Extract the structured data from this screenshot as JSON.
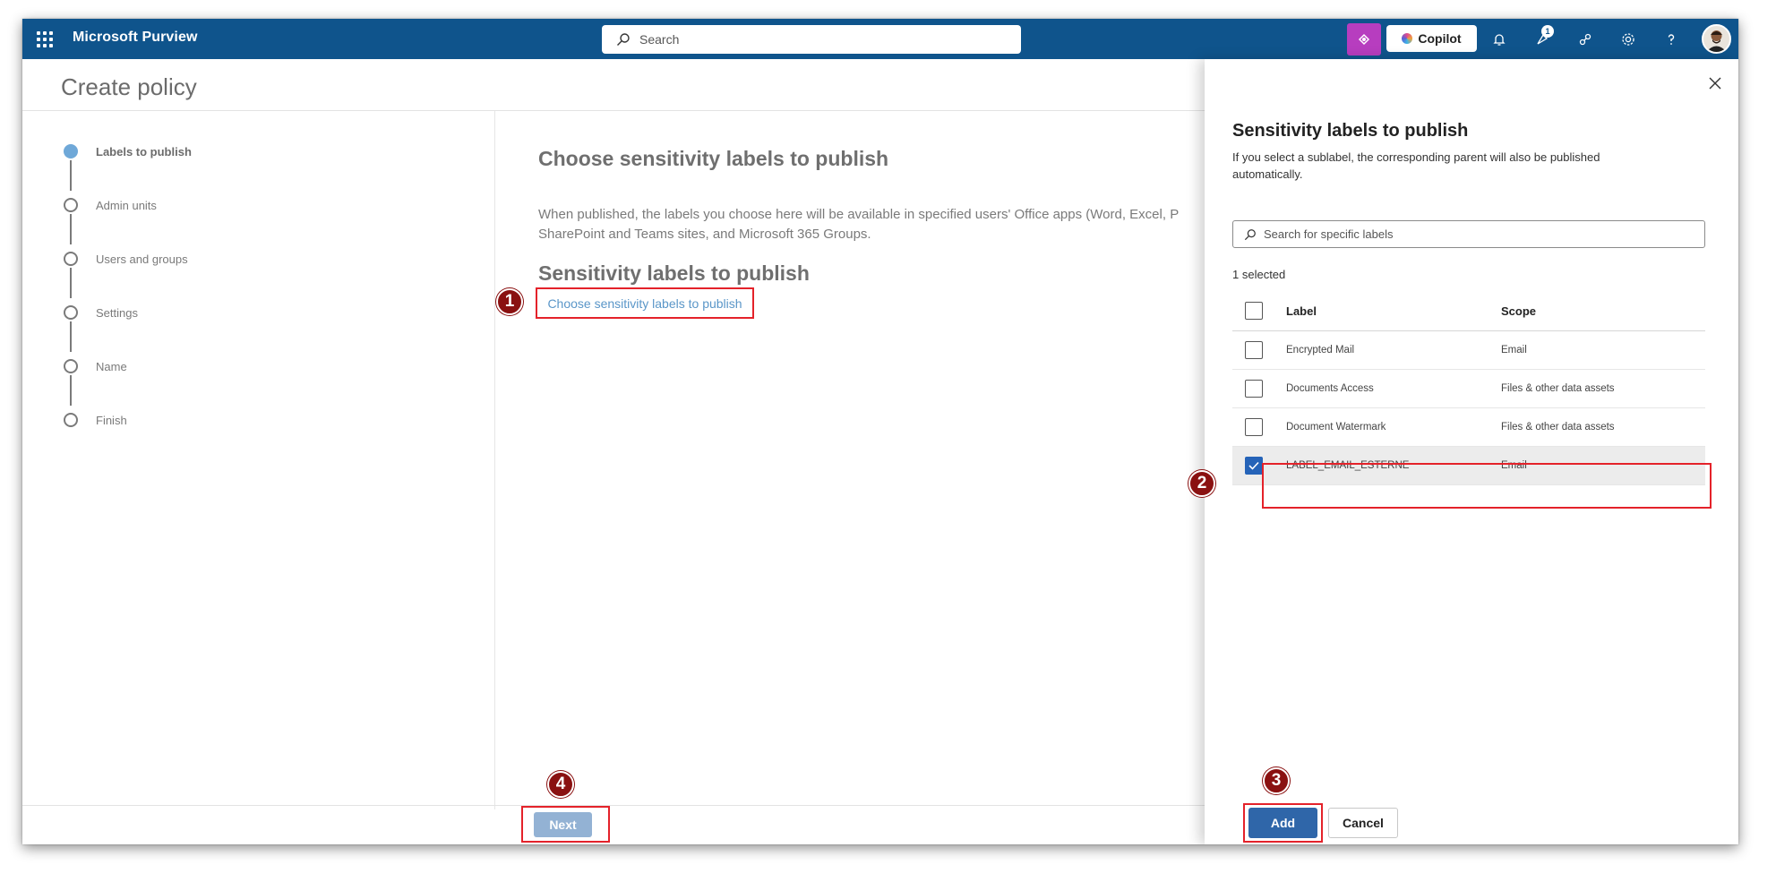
{
  "topbar": {
    "app_title": "Microsoft Purview",
    "search_placeholder": "Search",
    "copilot_label": "Copilot",
    "notification_count": "1"
  },
  "page": {
    "title": "Create policy"
  },
  "stepper": {
    "steps": [
      {
        "label": "Labels to publish",
        "active": true
      },
      {
        "label": "Admin units",
        "active": false
      },
      {
        "label": "Users and groups",
        "active": false
      },
      {
        "label": "Settings",
        "active": false
      },
      {
        "label": "Name",
        "active": false
      },
      {
        "label": "Finish",
        "active": false
      }
    ]
  },
  "main": {
    "heading": "Choose sensitivity labels to publish",
    "description": "When published, the labels you choose here will be available in specified users' Office apps (Word, Excel, P SharePoint and Teams sites, and Microsoft 365 Groups.",
    "section_heading": "Sensitivity labels to publish",
    "choose_link": "Choose sensitivity labels to publish",
    "next_label": "Next"
  },
  "callouts": [
    "1",
    "2",
    "3",
    "4"
  ],
  "panel": {
    "title": "Sensitivity labels to publish",
    "description": "If you select a sublabel, the corresponding parent will also be published automatically.",
    "search_placeholder": "Search for specific labels",
    "selected_count": "1 selected",
    "columns": {
      "label": "Label",
      "scope": "Scope"
    },
    "rows": [
      {
        "label": "Encrypted Mail",
        "scope": "Email",
        "checked": false
      },
      {
        "label": "Documents Access",
        "scope": "Files & other data assets",
        "checked": false
      },
      {
        "label": "Document Watermark",
        "scope": "Files & other data assets",
        "checked": false
      },
      {
        "label": "LABEL_EMAIL_ESTERNE",
        "scope": "Email",
        "checked": true
      }
    ],
    "add_label": "Add",
    "cancel_label": "Cancel"
  },
  "colors": {
    "topbar": "#0f548c",
    "accent": "#2f66a9",
    "callout": "#8a1111",
    "highlight_border": "#e4222a"
  }
}
